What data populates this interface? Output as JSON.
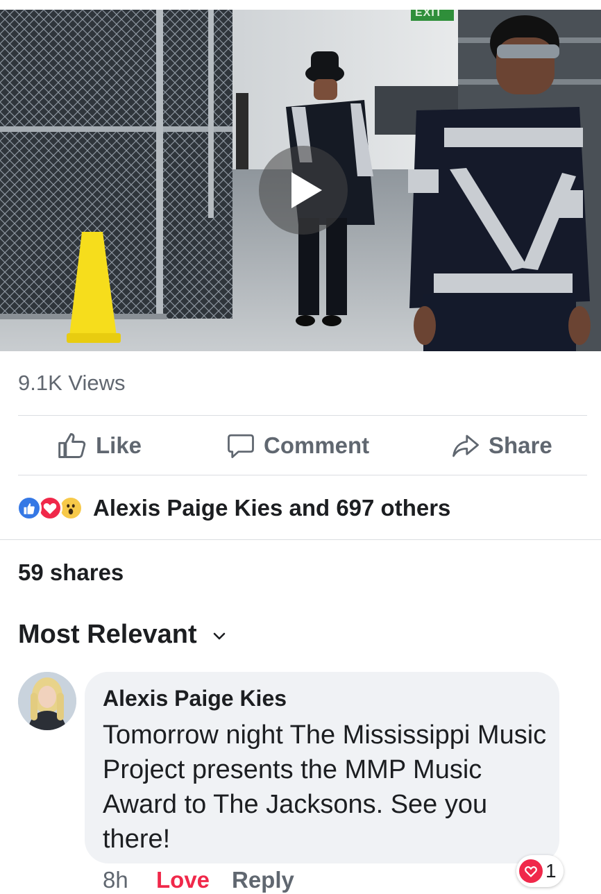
{
  "video": {
    "exit_sign": "EXIT",
    "play_icon": "play-icon"
  },
  "post": {
    "views": "9.1K Views",
    "actions": {
      "like": "Like",
      "comment": "Comment",
      "share": "Share"
    },
    "reactions": {
      "icons": [
        "like-reaction-icon",
        "love-reaction-icon",
        "wow-reaction-icon"
      ],
      "summary": "Alexis Paige Kies and 697 others"
    },
    "shares": "59 shares"
  },
  "comments": {
    "sort_label": "Most Relevant",
    "items": [
      {
        "author": "Alexis Paige Kies",
        "text": "Tomorrow night The Mississippi Music Project presents the MMP Music Award to The Jacksons. See you there!",
        "time": "8h",
        "love_label": "Love",
        "reply_label": "Reply",
        "reaction_count": "1"
      }
    ]
  },
  "colors": {
    "accent_blue": "#3578e5",
    "love_red": "#f0284a",
    "wow_yellow": "#f7c949",
    "secondary_text": "#606770",
    "bubble_bg": "#f0f2f5"
  }
}
